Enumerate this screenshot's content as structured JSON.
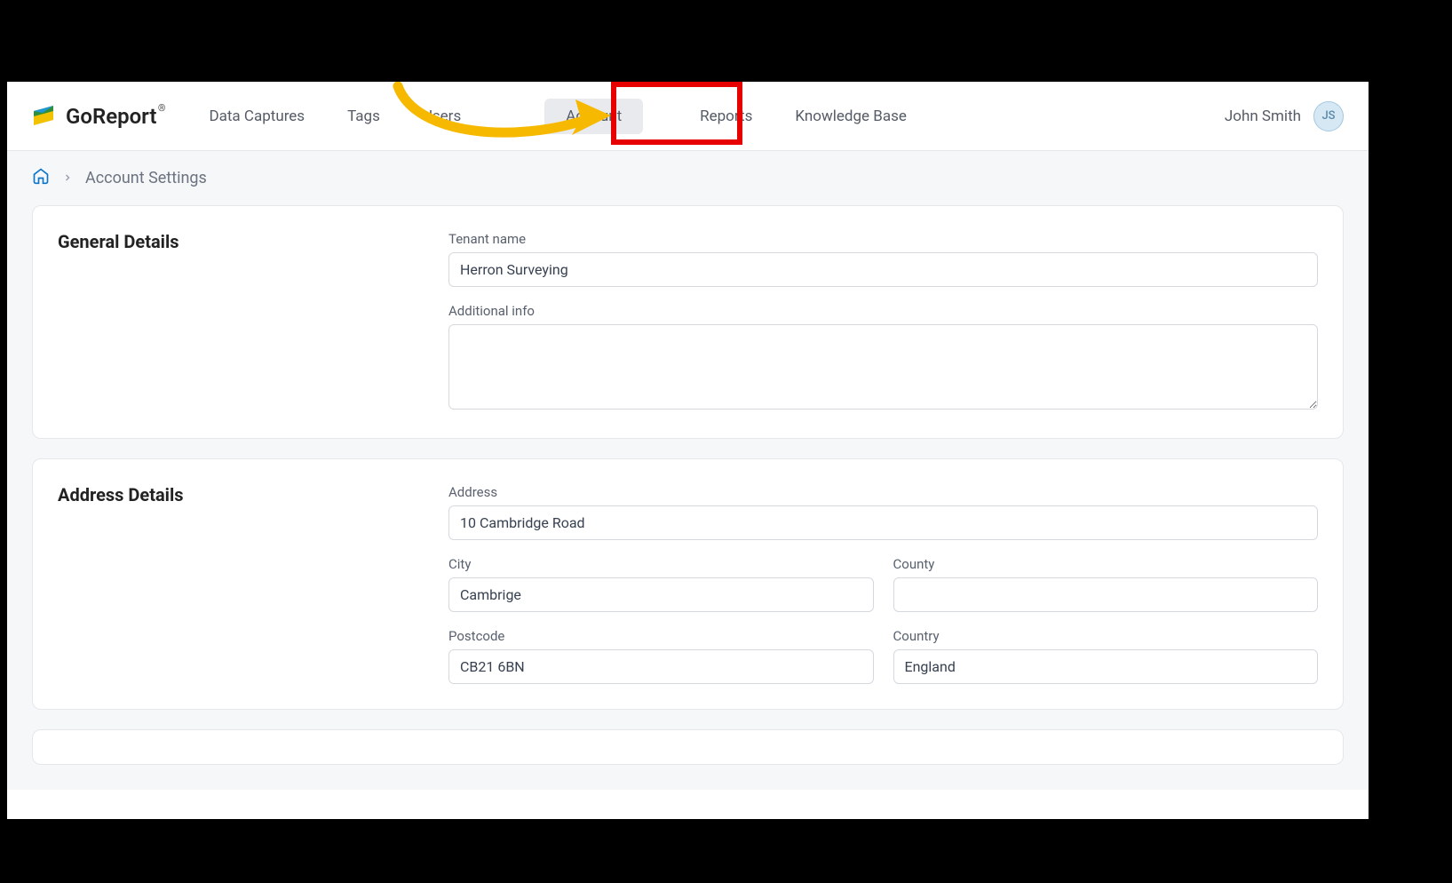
{
  "brand": {
    "name": "GoReport",
    "reg": "®"
  },
  "nav": {
    "data_captures": "Data Captures",
    "tags": "Tags",
    "users": "Users",
    "account": "Account",
    "reports": "Reports",
    "knowledge_base": "Knowledge Base"
  },
  "user": {
    "name": "John Smith",
    "initials": "JS"
  },
  "breadcrumb": {
    "page": "Account Settings"
  },
  "sections": {
    "general": {
      "title": "General Details",
      "tenant_label": "Tenant name",
      "tenant_value": "Herron Surveying",
      "additional_label": "Additional info",
      "additional_value": ""
    },
    "address": {
      "title": "Address Details",
      "address_label": "Address",
      "address_value": "10 Cambridge Road",
      "city_label": "City",
      "city_value": "Cambrige",
      "county_label": "County",
      "county_value": "",
      "postcode_label": "Postcode",
      "postcode_value": "CB21 6BN",
      "country_label": "Country",
      "country_value": "England"
    }
  }
}
